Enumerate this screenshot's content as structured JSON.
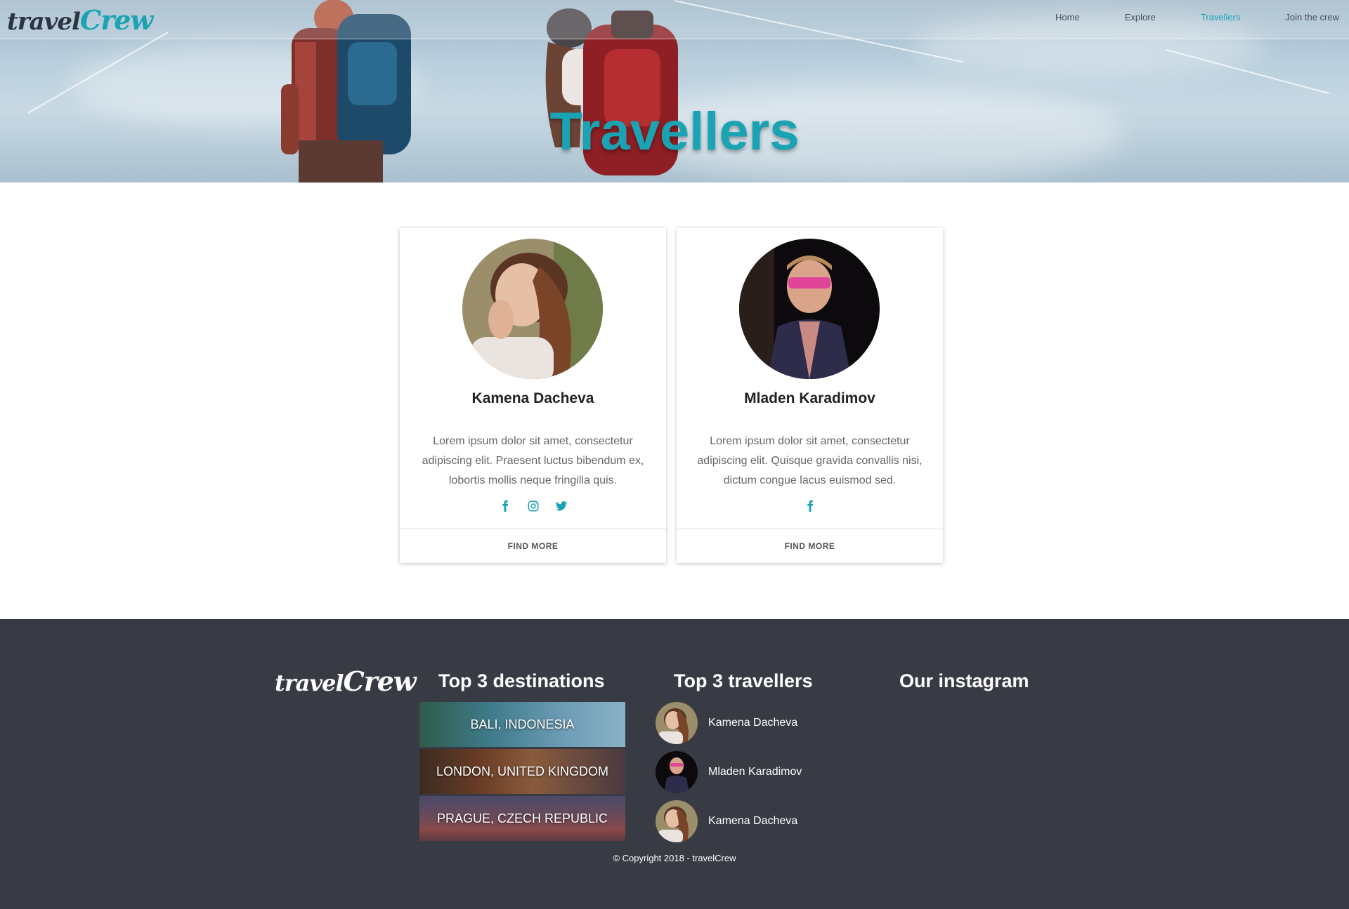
{
  "nav": {
    "logo_travel": "travel",
    "logo_crew": "Crew",
    "links": [
      {
        "label": "Home",
        "active": false
      },
      {
        "label": "Explore",
        "active": false
      },
      {
        "label": "Travellers",
        "active": true
      },
      {
        "label": "Join the crew",
        "active": false
      }
    ]
  },
  "hero": {
    "title": "Travellers"
  },
  "cards": [
    {
      "name": "Kamena Dacheva",
      "bio": "Lorem ipsum dolor sit amet, consectetur adipiscing elit. Praesent luctus bibendum ex, lobortis mollis neque fringilla quis.",
      "socials": [
        "facebook-icon",
        "instagram-icon",
        "twitter-icon"
      ],
      "cta": "FIND MORE"
    },
    {
      "name": "Mladen Karadimov",
      "bio": "Lorem ipsum dolor sit amet, consectetur adipiscing elit. Quisque gravida convallis nisi, dictum congue lacus euismod sed.",
      "socials": [
        "facebook-icon"
      ],
      "cta": "FIND MORE"
    }
  ],
  "footer": {
    "logo_travel": "travel",
    "logo_crew": "Crew",
    "destinations_title": "Top 3 destinations",
    "destinations": [
      "BALI, INDONESIA",
      "LONDON, UNITED KINGDOM",
      "PRAGUE, CZECH REPUBLIC"
    ],
    "travellers_title": "Top 3 travellers",
    "travellers": [
      "Kamena Dacheva",
      "Mladen Karadimov",
      "Kamena Dacheva"
    ],
    "instagram_title": "Our instagram",
    "copyright": "© Copyright 2018 - travelCrew"
  },
  "colors": {
    "accent": "#1aa3b3",
    "footer_bg": "#383b44",
    "text_dark": "#222222"
  }
}
